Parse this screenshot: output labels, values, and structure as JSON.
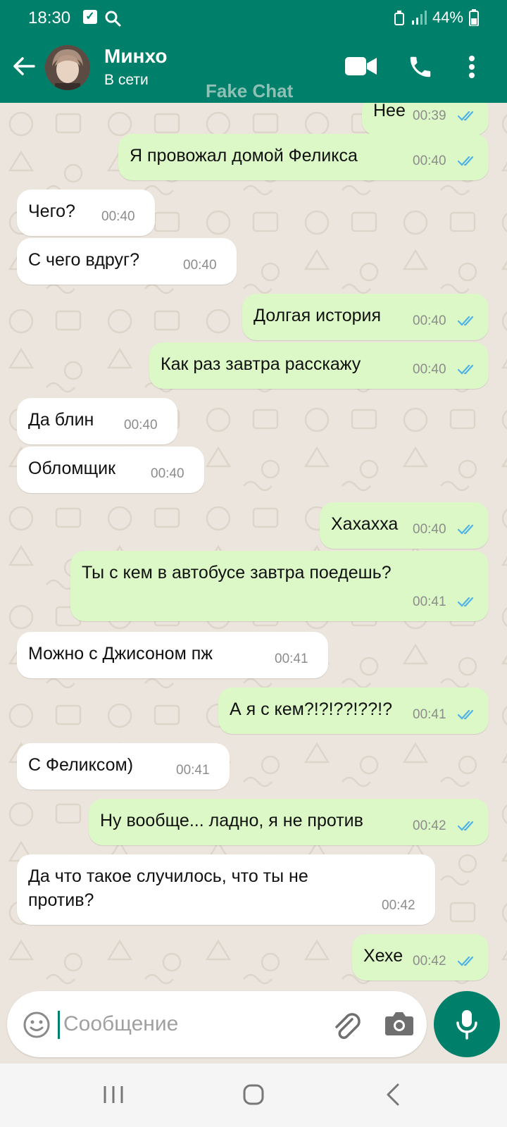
{
  "status_bar": {
    "time": "18:30",
    "battery": "44%"
  },
  "header": {
    "contact_name": "Минхо",
    "contact_status": "В сети",
    "watermark": "Fake Chat"
  },
  "messages": [
    {
      "dir": "out",
      "text": "Нее",
      "time": "00:39"
    },
    {
      "dir": "out",
      "text": "Я провожал домой Феликса",
      "time": "00:40"
    },
    {
      "dir": "in",
      "text": "Чего?",
      "time": "00:40"
    },
    {
      "dir": "in",
      "text": "С чего вдруг?",
      "time": "00:40"
    },
    {
      "dir": "out",
      "text": "Долгая история",
      "time": "00:40"
    },
    {
      "dir": "out",
      "text": "Как раз завтра расскажу",
      "time": "00:40"
    },
    {
      "dir": "in",
      "text": "Да блин",
      "time": "00:40"
    },
    {
      "dir": "in",
      "text": "Обломщик",
      "time": "00:40"
    },
    {
      "dir": "out",
      "text": "Хахахха",
      "time": "00:40"
    },
    {
      "dir": "out",
      "text": "Ты с кем в автобусе завтра поедешь?",
      "time": "00:41"
    },
    {
      "dir": "in",
      "text": "Можно с Джисоном пж",
      "time": "00:41"
    },
    {
      "dir": "out",
      "text": "А я с кем?!?!??!??!?",
      "time": "00:41"
    },
    {
      "dir": "in",
      "text": "С Феликсом)",
      "time": "00:41"
    },
    {
      "dir": "out",
      "text": "Ну вообще... ладно, я не против",
      "time": "00:42"
    },
    {
      "dir": "in",
      "text": "Да что такое случилось, что ты не\nпротив?",
      "time": "00:42"
    },
    {
      "dir": "out",
      "text": "Хехе",
      "time": "00:42"
    }
  ],
  "input": {
    "placeholder": "Сообщение"
  },
  "colors": {
    "header": "#00806a",
    "outgoing": "#dcf8c6",
    "incoming": "#ffffff",
    "ticks": "#4fb3e8"
  }
}
